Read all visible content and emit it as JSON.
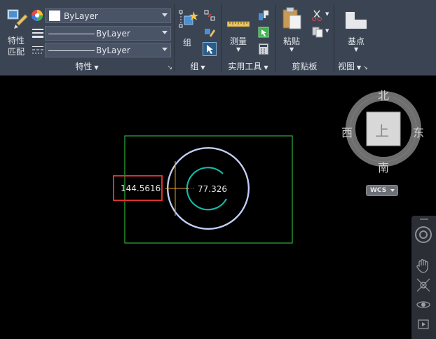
{
  "ribbon": {
    "properties": {
      "match_label_line1": "特性",
      "match_label_line2": "匹配",
      "color_value": "ByLayer",
      "linetype_value": "ByLayer",
      "lineweight_value": "ByLayer",
      "title": "特性"
    },
    "group": {
      "button_label": "组",
      "title": "组"
    },
    "utilities": {
      "measure_label": "测量",
      "title": "实用工具"
    },
    "clipboard": {
      "paste_label": "粘贴",
      "title": "剪贴板"
    },
    "view": {
      "basepoint_label": "基点",
      "title": "视图"
    }
  },
  "viewcube": {
    "north": "北",
    "south": "南",
    "east": "东",
    "west": "西",
    "face": "上",
    "wcs": "WCS"
  },
  "drawing": {
    "dimension_value": "144.5616",
    "radius_value": "77.326"
  },
  "colors": {
    "ribbon_bg": "#3b4453",
    "rect": "#2fae3a",
    "circle": "#b9c8ff",
    "arc": "#16b8a8",
    "highlight": "#d9312f"
  },
  "icons": [
    "match-properties-icon",
    "color-wheel-icon",
    "lineweight-icon",
    "linetype-icon",
    "group-icon",
    "ungroup-icon",
    "group-edit-icon",
    "group-select-icon",
    "measure-ruler-icon",
    "quick-calc-icon",
    "paste-icon",
    "cut-icon",
    "copy-icon",
    "basepoint-icon",
    "orbit-icon",
    "pan-hand-icon",
    "zoom-icon",
    "showmotion-icon"
  ]
}
